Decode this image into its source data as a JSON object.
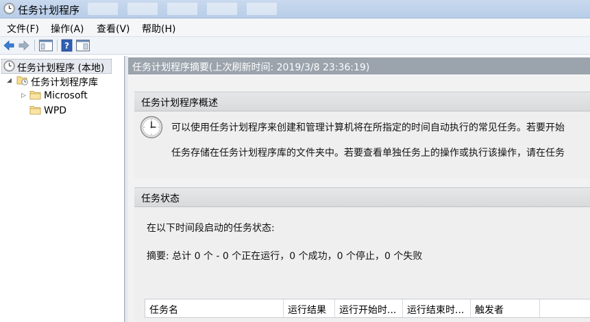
{
  "window": {
    "title": "任务计划程序"
  },
  "menu": {
    "items": [
      "文件(F)",
      "操作(A)",
      "查看(V)",
      "帮助(H)"
    ]
  },
  "toolbar": {
    "buttons": [
      "back-icon",
      "forward-icon",
      "show-console-tree-icon",
      "help-icon",
      "show-action-pane-icon"
    ]
  },
  "tree": {
    "root": "任务计划程序 (本地)",
    "library": "任务计划程序库",
    "children": [
      "Microsoft",
      "WPD"
    ]
  },
  "main": {
    "header": "任务计划程序摘要(上次刷新时间: 2019/3/8 23:36:19)",
    "overview": {
      "title": "任务计划程序概述",
      "line1": "可以使用任务计划程序来创建和管理计算机将在所指定的时间自动执行的常见任务。若要开始",
      "line2": "任务存储在任务计划程序库的文件夹中。若要查看单独任务上的操作或执行该操作，请在任务"
    },
    "status": {
      "title": "任务状态",
      "intro": "在以下时间段启动的任务状态:",
      "summary": "摘要: 总计 0 个 - 0 个正在运行，0 个成功，0 个停止，0 个失败"
    },
    "table": {
      "columns": [
        "任务名",
        "运行结果",
        "运行开始时...",
        "运行结束时...",
        "触发者"
      ]
    }
  }
}
